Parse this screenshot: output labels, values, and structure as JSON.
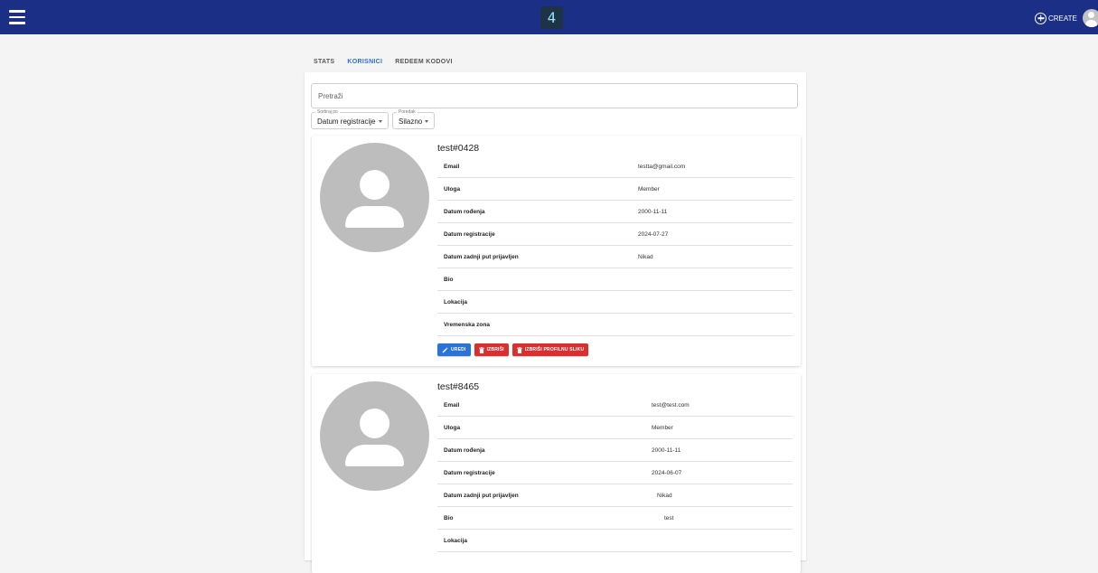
{
  "header": {
    "logo_text": "4",
    "create_label": "CREATE",
    "bar_color": "#1b2f86",
    "icons": [
      "menu-icon",
      "plus-circle-icon",
      "account-icon"
    ]
  },
  "tabs": [
    {
      "label": "STATS",
      "active": false
    },
    {
      "label": "KORISNICI",
      "active": true
    },
    {
      "label": "REDEEM KODOVI",
      "active": false
    }
  ],
  "search": {
    "placeholder": "Pretraži"
  },
  "filters": {
    "sort_label": "Sortiraj po",
    "sort_value": "Datum registracije",
    "order_label": "Poredak",
    "order_value": "Silazno"
  },
  "field_labels": {
    "email": "Email",
    "role": "Uloga",
    "birth": "Datum rođenja",
    "registered": "Datum registracije",
    "last_login": "Datum zadnji put prijavljen",
    "bio": "Bio",
    "location": "Lokacija",
    "timezone": "Vremenska zona"
  },
  "actions": {
    "edit": "UREDI",
    "delete": "IZBRIŠI",
    "delete_picture": "IZBRIŠI PROFILNU SLIKU"
  },
  "users": [
    {
      "username": "test#0428",
      "email": "testta@gmail.com",
      "role": "Member",
      "birth": "2000-11-11",
      "registered": "2024-07-27",
      "last_login": "Nikad",
      "bio": "",
      "location": "",
      "timezone": ""
    },
    {
      "username": "test#8465",
      "email": "test@test.com",
      "role": "Member",
      "birth": "2000-11-11",
      "registered": "2024-06-07",
      "last_login": "Nikad",
      "bio": "test",
      "location": ""
    }
  ]
}
